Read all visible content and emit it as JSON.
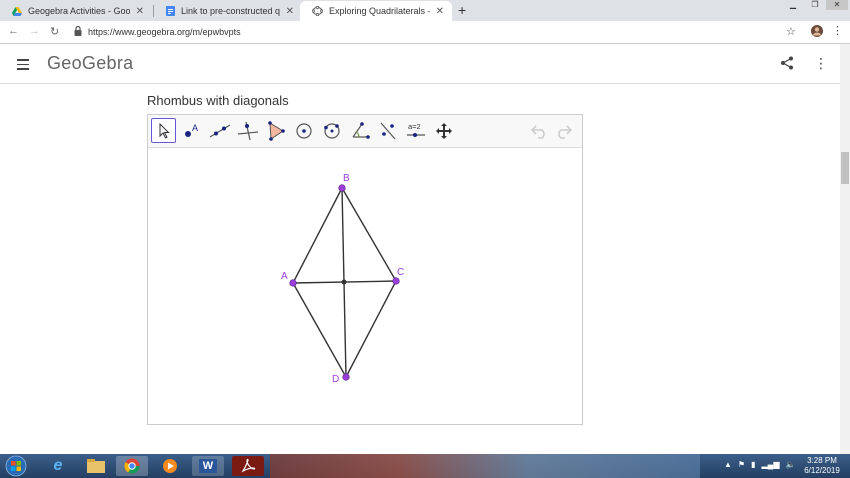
{
  "browser": {
    "tabs": [
      {
        "title": "Geogebra Activities - Google Dr…",
        "icon": "google-drive-icon"
      },
      {
        "title": "Link to pre-constructed quads - E",
        "icon": "docs-icon"
      },
      {
        "title": "Exploring Quadrilaterals – GeoGe",
        "icon": "geogebra-icon",
        "active": true
      }
    ],
    "url": "https://www.geogebra.org/m/epwbvpts"
  },
  "header": {
    "logo": "GeoGebra"
  },
  "applet": {
    "title": "Rhombus with diagonals",
    "tools": [
      "move",
      "point",
      "line",
      "perpendicular",
      "polygon",
      "circle",
      "circle-3-points",
      "angle",
      "reflect",
      "slider",
      "move-graphics"
    ],
    "slider_label": "a=2",
    "points": {
      "A": "A",
      "B": "B",
      "C": "C",
      "D": "D"
    },
    "point_color": "#9b3fd9"
  },
  "taskbar": {
    "time": "3:28 PM",
    "date": "6/12/2019"
  }
}
